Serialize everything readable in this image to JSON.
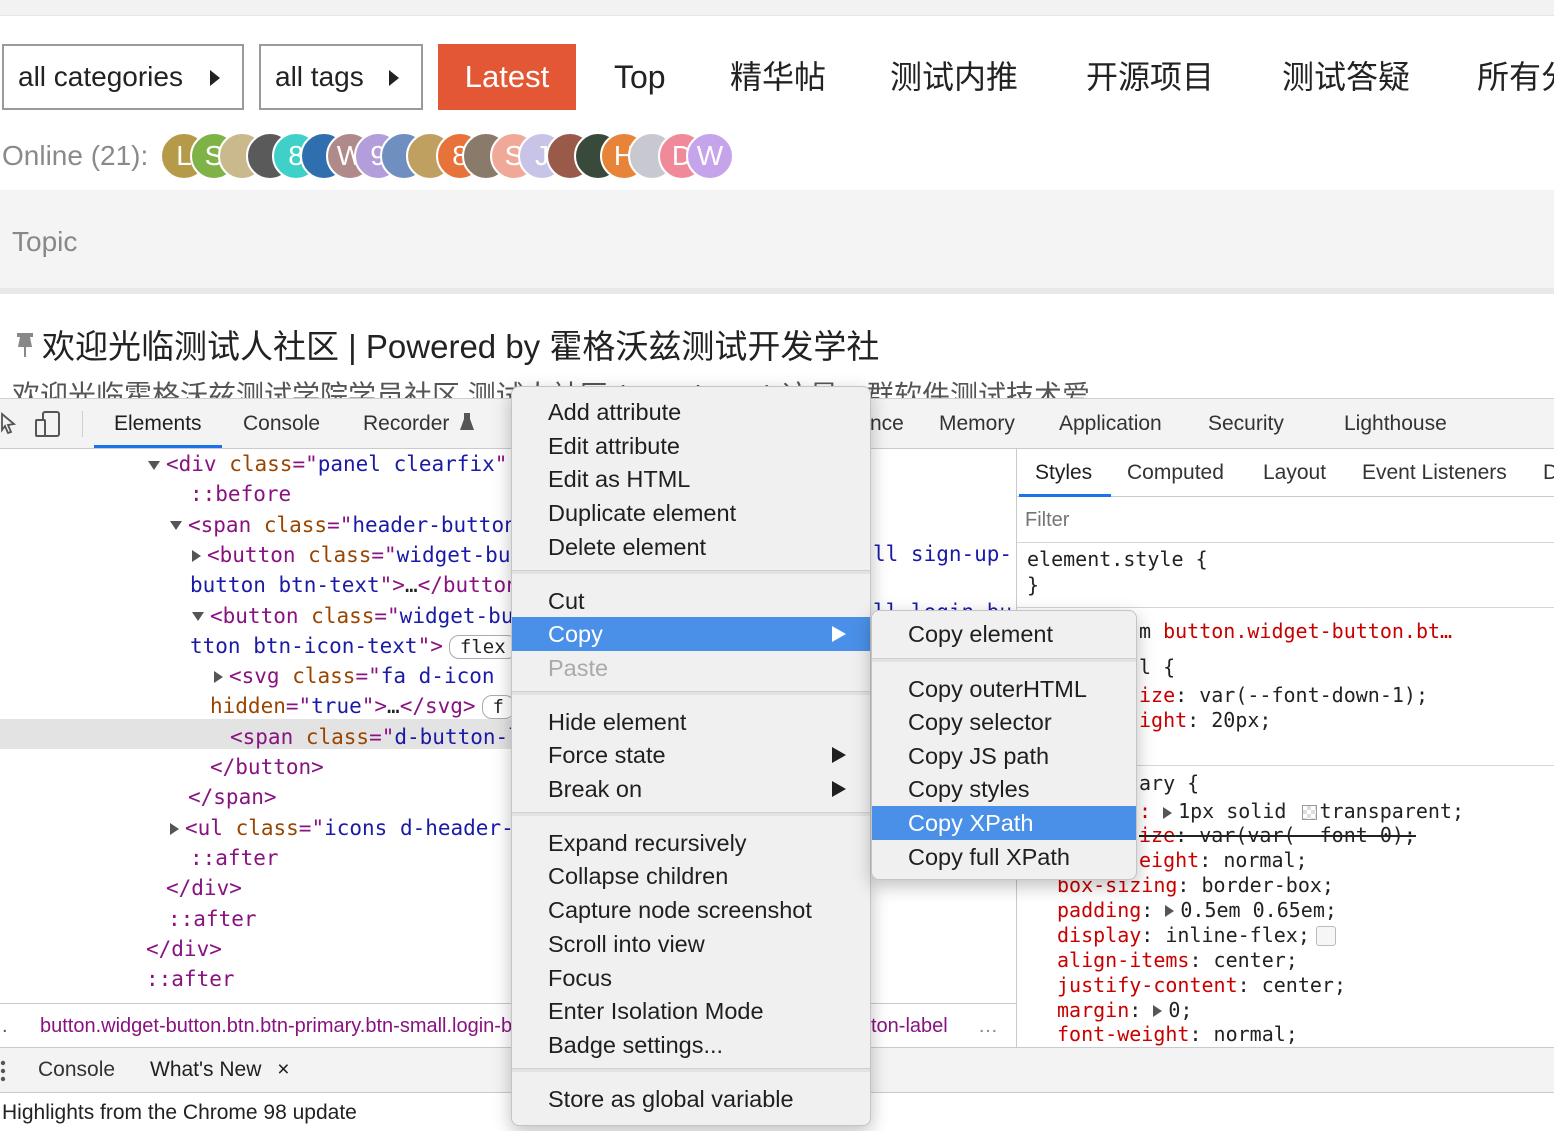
{
  "site": {
    "nav": {
      "categories_label": "all categories",
      "tags_label": "all tags",
      "latest_label": "Latest",
      "links": [
        "Top",
        "精华帖",
        "测试内推",
        "开源项目",
        "测试答疑",
        "所有分"
      ]
    },
    "online_label": "Online (21):",
    "online_avatars": [
      {
        "initial": "L",
        "color": "#b59a4a"
      },
      {
        "initial": "S",
        "color": "#7fb347"
      },
      {
        "initial": "",
        "color": "#c9b98c"
      },
      {
        "initial": "",
        "color": "#5a5a5a"
      },
      {
        "initial": "8",
        "color": "#3fd1c8"
      },
      {
        "initial": "",
        "color": "#2f6fb0"
      },
      {
        "initial": "W",
        "color": "#b08a8a"
      },
      {
        "initial": "9",
        "color": "#b39ddb"
      },
      {
        "initial": "",
        "color": "#6f8fc0"
      },
      {
        "initial": "",
        "color": "#c0a060"
      },
      {
        "initial": "8",
        "color": "#e8733a"
      },
      {
        "initial": "",
        "color": "#8a7a6a"
      },
      {
        "initial": "S",
        "color": "#f0a898"
      },
      {
        "initial": "J",
        "color": "#c8c4e8"
      },
      {
        "initial": "",
        "color": "#9a5a4a"
      },
      {
        "initial": "",
        "color": "#3a4a3a"
      },
      {
        "initial": "H",
        "color": "#e8833a"
      },
      {
        "initial": "",
        "color": "#c8c8d0"
      },
      {
        "initial": "D",
        "color": "#f08a9a"
      },
      {
        "initial": "W",
        "color": "#c6a4ec"
      }
    ],
    "topic_column_label": "Topic",
    "topic_title": "欢迎光临测试人社区 | Powered by 霍格沃兹测试开发学社",
    "topic_excerpt": "欢迎光临霍格沃兹测试学院学员社区 测试人社区 (testerhome) 这是一群软件测试技术爱"
  },
  "devtools": {
    "tabs": [
      "Elements",
      "Console",
      "Recorder",
      "nce",
      "Memory",
      "Application",
      "Security",
      "Lighthouse"
    ],
    "dom_lines": [
      {
        "parts": [
          [
            "tg",
            "<div "
          ],
          [
            "at",
            "class"
          ],
          [
            "tg",
            "=\""
          ],
          [
            "av2",
            "panel clearfix"
          ],
          [
            "tg",
            "\""
          ]
        ]
      },
      {
        "parts": [
          [
            "ps",
            "::before"
          ]
        ]
      },
      {
        "parts": [
          [
            "tg",
            "<span "
          ],
          [
            "at",
            "class"
          ],
          [
            "tg",
            "=\""
          ],
          [
            "av2",
            "header-button"
          ]
        ]
      },
      {
        "parts": [
          [
            "tg",
            "<button "
          ],
          [
            "at",
            "class"
          ],
          [
            "tg",
            "=\""
          ],
          [
            "av2",
            "widget-button"
          ]
        ]
      },
      {
        "parts": [
          [
            "av2",
            "button btn-text"
          ],
          [
            "tg",
            "\">"
          ],
          [
            "tx",
            "…"
          ],
          [
            "tg",
            "</button>"
          ]
        ]
      },
      {
        "parts": [
          [
            "tg",
            "<button "
          ],
          [
            "at",
            "class"
          ],
          [
            "tg",
            "=\""
          ],
          [
            "av2",
            "widget-button"
          ]
        ]
      },
      {
        "parts": [
          [
            "av2",
            "tton btn-icon-text"
          ],
          [
            "tg",
            "\">"
          ]
        ],
        "pill": "flex"
      },
      {
        "parts": [
          [
            "tg",
            "<svg "
          ],
          [
            "at",
            "class"
          ],
          [
            "tg",
            "=\""
          ],
          [
            "av2",
            "fa d-icon"
          ]
        ]
      },
      {
        "parts": [
          [
            "at",
            "hidden"
          ],
          [
            "tg",
            "=\""
          ],
          [
            "av2",
            "true"
          ],
          [
            "tg",
            "\">"
          ],
          [
            "tx",
            "…"
          ],
          [
            "tg",
            "</svg>"
          ]
        ],
        "pill": "f"
      },
      {
        "parts": [
          [
            "tg",
            "<span "
          ],
          [
            "at",
            "class"
          ],
          [
            "tg",
            "=\""
          ],
          [
            "av2",
            "d-button-label"
          ]
        ]
      },
      {
        "parts": [
          [
            "tg",
            "</button>"
          ]
        ]
      },
      {
        "parts": [
          [
            "tg",
            "</span>"
          ]
        ]
      },
      {
        "parts": [
          [
            "tg",
            "<ul "
          ],
          [
            "at",
            "class"
          ],
          [
            "tg",
            "=\""
          ],
          [
            "av2",
            "icons d-header-icons"
          ]
        ]
      },
      {
        "parts": [
          [
            "ps",
            "::after"
          ]
        ]
      },
      {
        "parts": [
          [
            "tg",
            "</div>"
          ]
        ]
      },
      {
        "parts": [
          [
            "ps",
            "::after"
          ]
        ]
      },
      {
        "parts": [
          [
            "tg",
            "</div>"
          ]
        ]
      },
      {
        "parts": [
          [
            "ps",
            "::after"
          ]
        ]
      }
    ],
    "dom_partial_right_1": "ll sign-up-",
    "dom_partial_right_2": "ll login-bu",
    "breadcrumb": "button.widget-button.btn.btn-primary.btn-small.login-button",
    "breadcrumb_right": "ton-label",
    "breadcrumb_more": "…",
    "styles_tabs": [
      "Styles",
      "Computed",
      "Layout",
      "Event Listeners",
      "D"
    ],
    "filter_placeholder": "Filter",
    "element_style_open": "element.style {",
    "element_style_close": "}",
    "rule_source_prefix": "m",
    "rule_source_selector": "button.widget-button.bt…",
    "rule1_open": "l {",
    "rule1_props": [
      {
        "p": "ize",
        "v": "var(--font-down-1);"
      },
      {
        "p": "ight",
        "v": "20px;"
      }
    ],
    "rule2_open": "ary {",
    "rule2_border": "1px solid",
    "rule2_border_color": "transparent;",
    "rule2_strike_prop": "ize",
    "rule2_strike_val": "var(--font-0);",
    "rule2_line_height": {
      "p": "eight",
      "v": "normal;"
    },
    "rule2_props": [
      {
        "p": "box-sizing",
        "v": "border-box;"
      },
      {
        "p": "padding",
        "v": "0.5em 0.65em;"
      },
      {
        "p": "display",
        "v": "inline-flex;"
      },
      {
        "p": "align-items",
        "v": "center;"
      },
      {
        "p": "justify-content",
        "v": "center;"
      },
      {
        "p": "margin",
        "v": "0;"
      },
      {
        "p": "font-weight",
        "v": "normal;"
      }
    ],
    "drawer_tabs": [
      "Console",
      "What's New"
    ],
    "drawer_close": "×",
    "whats_new_text": "Highlights from the Chrome 98 update"
  },
  "context_menu": {
    "groups": [
      [
        "Add attribute",
        "Edit attribute",
        "Edit as HTML",
        "Duplicate element",
        "Delete element"
      ],
      [
        "Cut",
        "Copy",
        "Paste"
      ],
      [
        "Hide element",
        "Force state",
        "Break on"
      ],
      [
        "Expand recursively",
        "Collapse children",
        "Capture node screenshot",
        "Scroll into view",
        "Focus",
        "Enter Isolation Mode",
        "Badge settings..."
      ],
      [
        "Store as global variable"
      ]
    ],
    "highlighted": "Copy",
    "disabled": [
      "Paste"
    ],
    "with_submenu": [
      "Copy",
      "Force state",
      "Break on"
    ]
  },
  "copy_submenu": {
    "groups": [
      [
        "Copy element"
      ],
      [
        "Copy outerHTML",
        "Copy selector",
        "Copy JS path",
        "Copy styles",
        "Copy XPath",
        "Copy full XPath"
      ]
    ],
    "highlighted": "Copy XPath"
  },
  "colors": {
    "accent": "#e45735",
    "menu_highlight": "#4a90e8",
    "devtools_blue": "#1a73e8"
  }
}
